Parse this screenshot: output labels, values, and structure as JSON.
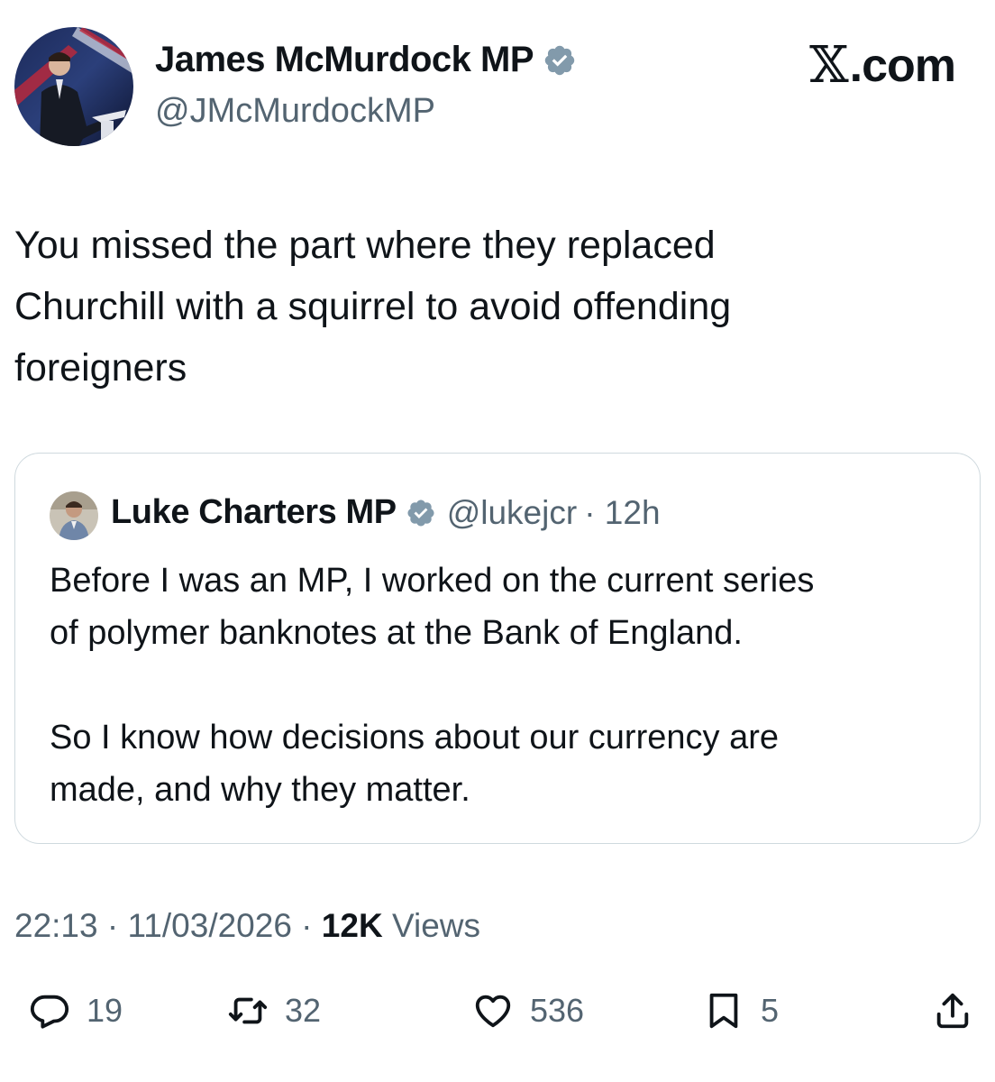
{
  "brand": {
    "name": ".com",
    "icon": "x-logo-icon"
  },
  "author": {
    "name": "James McMurdock MP",
    "handle": "@JMcMurdockMP",
    "verified_icon": "verified-badge-icon",
    "avatar": "avatar-photo"
  },
  "tweet": {
    "lines": [
      "You missed the part where they replaced",
      "Churchill with a squirrel to avoid offending",
      "foreigners"
    ]
  },
  "quote": {
    "name": "Luke Charters MP",
    "handle": "@lukejcr",
    "time": "· 12h",
    "para1": [
      "Before I was an MP, I worked on the current series",
      "of polymer banknotes at the Bank of England."
    ],
    "para2": [
      "So I know how decisions about our currency are",
      "made, and why they matter."
    ]
  },
  "meta": {
    "time": "22:13 · 11/03/2026 · ",
    "views_count": "12K",
    "views_label": " Views"
  },
  "actions": {
    "replies": "19",
    "reposts": "32",
    "likes": "536",
    "bookmarks": "5"
  },
  "colors": {
    "text": "#0f1419",
    "secondary": "#536471",
    "verified": "#829aab",
    "border": "#cfd9de"
  }
}
